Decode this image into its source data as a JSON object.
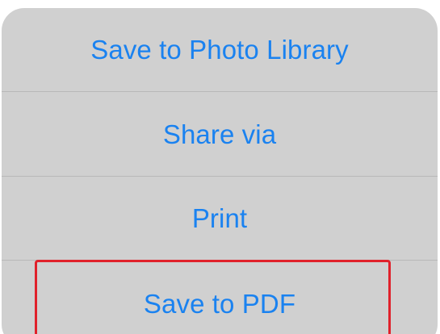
{
  "action_sheet": {
    "items": [
      {
        "label": "Save to Photo Library"
      },
      {
        "label": "Share via"
      },
      {
        "label": "Print"
      },
      {
        "label": "Save to PDF"
      }
    ]
  },
  "colors": {
    "sheet_background": "#d0d0d0",
    "action_text": "#1a82f0",
    "separator": "#b9b9b9",
    "highlight_border": "#e0212b"
  }
}
